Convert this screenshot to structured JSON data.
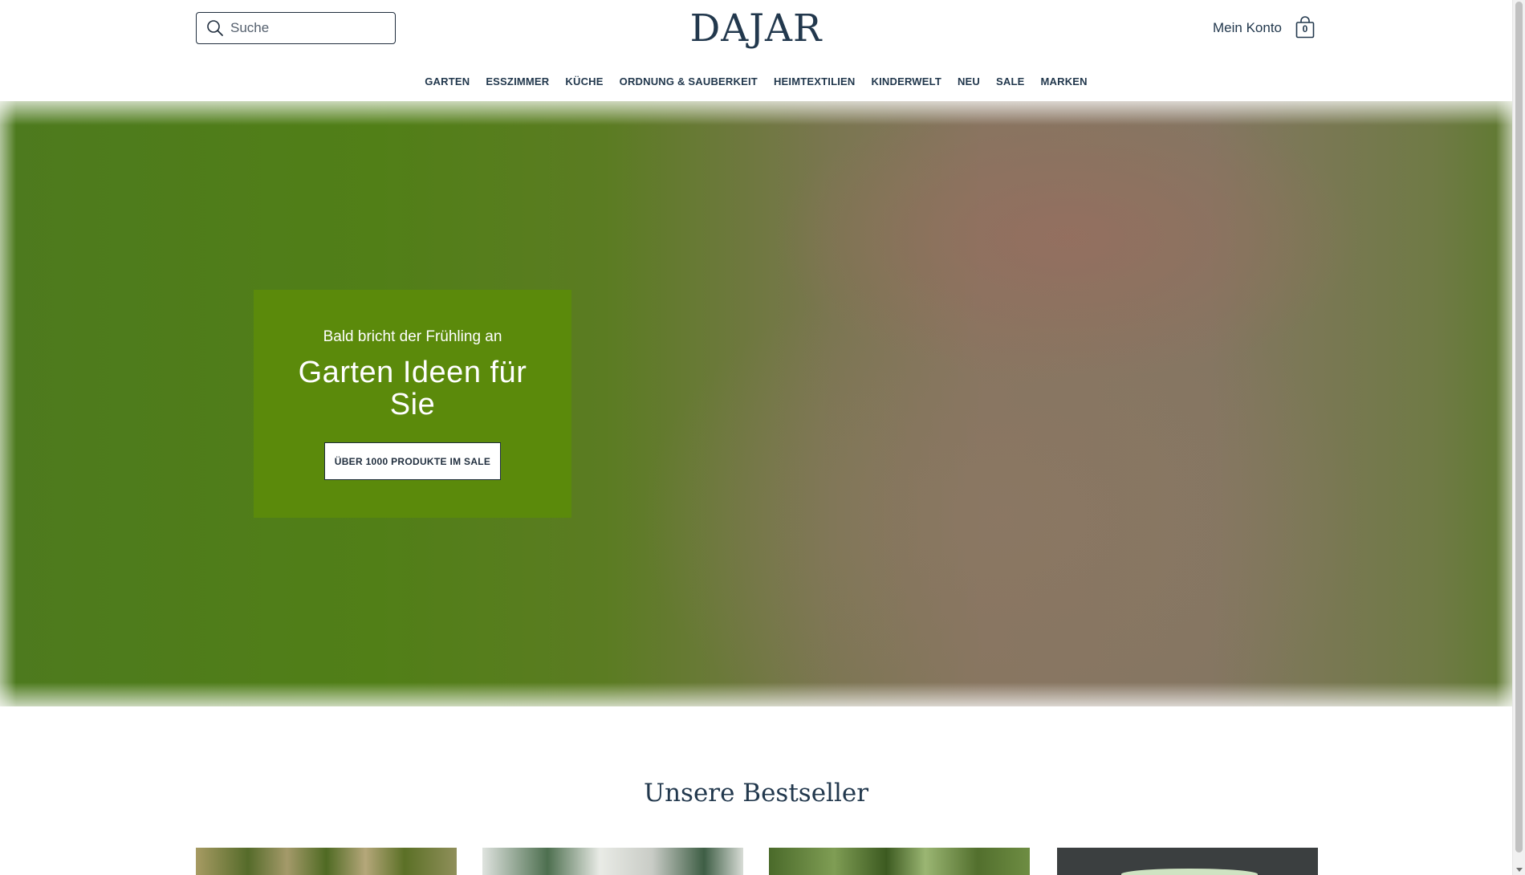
{
  "header": {
    "search": {
      "placeholder": "Suche",
      "value": ""
    },
    "logo": "DAJAR",
    "account_label": "Mein Konto",
    "cart_count": "0"
  },
  "nav": {
    "items": [
      {
        "label": "GARTEN"
      },
      {
        "label": "ESSZIMMER"
      },
      {
        "label": "KÜCHE"
      },
      {
        "label": "ORDNUNG & SAUBERKEIT"
      },
      {
        "label": "HEIMTEXTILIEN"
      },
      {
        "label": "KINDERWELT"
      },
      {
        "label": "NEU"
      },
      {
        "label": "SALE"
      },
      {
        "label": "MARKEN"
      }
    ]
  },
  "hero": {
    "kicker": "Bald bricht der Frühling an",
    "title": "Garten Ideen für Sie",
    "button_label": "ÜBER 1000 PRODUKTE IM SALE",
    "card_color": "#5b8a0b"
  },
  "bestseller": {
    "title": "Unsere Bestseller"
  },
  "colors": {
    "brand_text": "#22384d",
    "hero_green": "#5b8a0b"
  },
  "icons": {
    "search": "search-icon",
    "cart": "shopping-bag-icon"
  }
}
